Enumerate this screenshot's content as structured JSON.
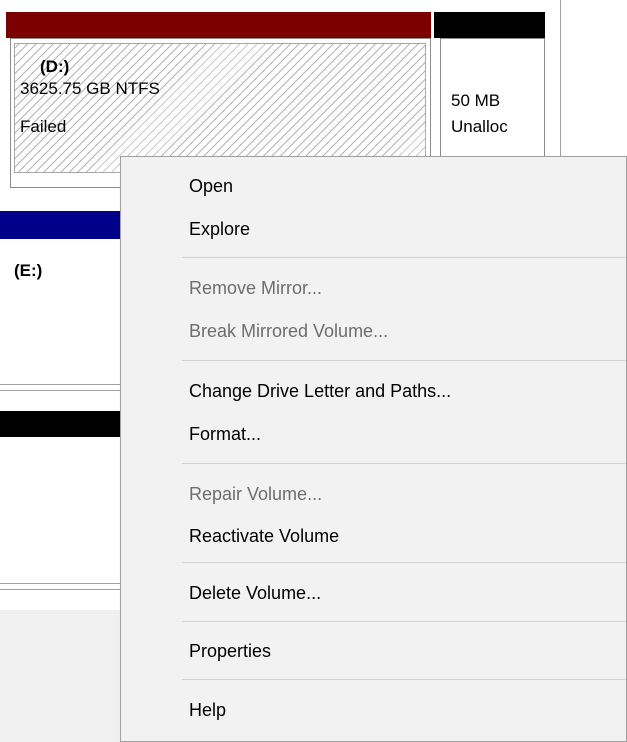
{
  "disk_map": {
    "volume_d": {
      "name": "(D:)",
      "size": "3625.75 GB NTFS",
      "status": "Failed",
      "bar_color": "#7b0000"
    },
    "unallocated": {
      "size": "50 MB",
      "label": "Unalloc",
      "bar_color": "#000000"
    },
    "volume_e": {
      "name": "(E:)",
      "bar_color": "#00008b"
    }
  },
  "context_menu": {
    "items": [
      {
        "label": "Open",
        "enabled": true
      },
      {
        "label": "Explore",
        "enabled": true
      },
      {
        "label": "Remove Mirror...",
        "enabled": false
      },
      {
        "label": "Break Mirrored Volume...",
        "enabled": false
      },
      {
        "label": "Change Drive Letter and Paths...",
        "enabled": true
      },
      {
        "label": "Format...",
        "enabled": true
      },
      {
        "label": "Repair Volume...",
        "enabled": false
      },
      {
        "label": "Reactivate Volume",
        "enabled": true
      },
      {
        "label": "Delete Volume...",
        "enabled": true
      },
      {
        "label": "Properties",
        "enabled": true
      },
      {
        "label": "Help",
        "enabled": true
      }
    ]
  }
}
